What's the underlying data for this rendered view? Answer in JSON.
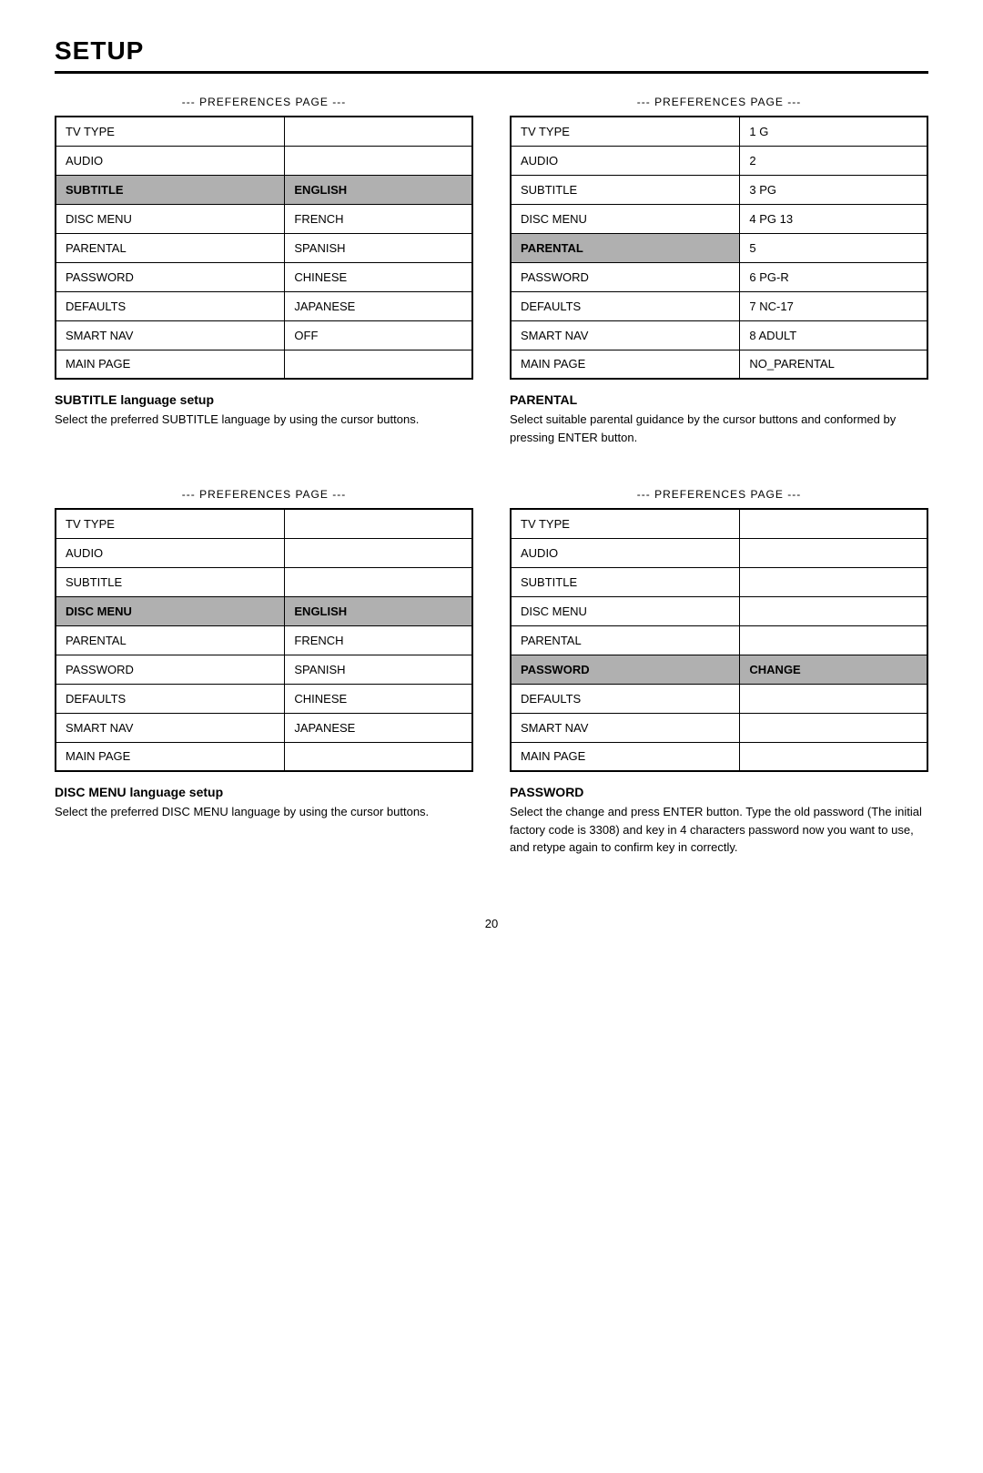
{
  "page": {
    "title": "SETUP",
    "page_number": "20"
  },
  "sections": [
    {
      "id": "top-left",
      "pref_label": "--- PREFERENCES PAGE ---",
      "rows": [
        {
          "left": "TV TYPE",
          "right": "",
          "left_highlight": false,
          "right_highlight": false
        },
        {
          "left": "AUDIO",
          "right": "",
          "left_highlight": false,
          "right_highlight": false
        },
        {
          "left": "SUBTITLE",
          "right": "ENGLISH",
          "left_highlight": true,
          "right_highlight": true
        },
        {
          "left": "DISC MENU",
          "right": "FRENCH",
          "left_highlight": false,
          "right_highlight": false
        },
        {
          "left": "PARENTAL",
          "right": "SPANISH",
          "left_highlight": false,
          "right_highlight": false
        },
        {
          "left": "PASSWORD",
          "right": "CHINESE",
          "left_highlight": false,
          "right_highlight": false
        },
        {
          "left": "DEFAULTS",
          "right": "JAPANESE",
          "left_highlight": false,
          "right_highlight": false
        },
        {
          "left": "SMART NAV",
          "right": "OFF",
          "left_highlight": false,
          "right_highlight": false
        },
        {
          "left": "MAIN PAGE",
          "right": "",
          "left_highlight": false,
          "right_highlight": false
        }
      ],
      "desc_title": "SUBTITLE language setup",
      "desc_text": "Select the preferred SUBTITLE language by using the cursor buttons."
    },
    {
      "id": "top-right",
      "pref_label": "--- PREFERENCES PAGE ---",
      "rows": [
        {
          "left": "TV TYPE",
          "right": "1 G",
          "left_highlight": false,
          "right_highlight": false
        },
        {
          "left": "AUDIO",
          "right": "2",
          "left_highlight": false,
          "right_highlight": false
        },
        {
          "left": "SUBTITLE",
          "right": "3 PG",
          "left_highlight": false,
          "right_highlight": false
        },
        {
          "left": "DISC MENU",
          "right": "4 PG 13",
          "left_highlight": false,
          "right_highlight": false
        },
        {
          "left": "PARENTAL",
          "right": "5",
          "left_highlight": true,
          "right_highlight": false
        },
        {
          "left": "PASSWORD",
          "right": "6 PG-R",
          "left_highlight": false,
          "right_highlight": false
        },
        {
          "left": "DEFAULTS",
          "right": "7 NC-17",
          "left_highlight": false,
          "right_highlight": false
        },
        {
          "left": "SMART NAV",
          "right": "8 ADULT",
          "left_highlight": false,
          "right_highlight": false
        },
        {
          "left": "MAIN PAGE",
          "right": "NO_PARENTAL",
          "left_highlight": false,
          "right_highlight": false
        }
      ],
      "desc_title": "PARENTAL",
      "desc_text": "Select suitable parental guidance by the cursor buttons and conformed by pressing ENTER button."
    },
    {
      "id": "bottom-left",
      "pref_label": "--- PREFERENCES PAGE ---",
      "rows": [
        {
          "left": "TV TYPE",
          "right": "",
          "left_highlight": false,
          "right_highlight": false
        },
        {
          "left": "AUDIO",
          "right": "",
          "left_highlight": false,
          "right_highlight": false
        },
        {
          "left": "SUBTITLE",
          "right": "",
          "left_highlight": false,
          "right_highlight": false
        },
        {
          "left": "DISC MENU",
          "right": "ENGLISH",
          "left_highlight": true,
          "right_highlight": true
        },
        {
          "left": "PARENTAL",
          "right": "FRENCH",
          "left_highlight": false,
          "right_highlight": false
        },
        {
          "left": "PASSWORD",
          "right": "SPANISH",
          "left_highlight": false,
          "right_highlight": false
        },
        {
          "left": "DEFAULTS",
          "right": "CHINESE",
          "left_highlight": false,
          "right_highlight": false
        },
        {
          "left": "SMART NAV",
          "right": "JAPANESE",
          "left_highlight": false,
          "right_highlight": false
        },
        {
          "left": "MAIN PAGE",
          "right": "",
          "left_highlight": false,
          "right_highlight": false
        }
      ],
      "desc_title": "DISC MENU language setup",
      "desc_text": "Select the preferred DISC MENU language by using the cursor buttons."
    },
    {
      "id": "bottom-right",
      "pref_label": "--- PREFERENCES PAGE ---",
      "rows": [
        {
          "left": "TV TYPE",
          "right": "",
          "left_highlight": false,
          "right_highlight": false
        },
        {
          "left": "AUDIO",
          "right": "",
          "left_highlight": false,
          "right_highlight": false
        },
        {
          "left": "SUBTITLE",
          "right": "",
          "left_highlight": false,
          "right_highlight": false
        },
        {
          "left": "DISC MENU",
          "right": "",
          "left_highlight": false,
          "right_highlight": false
        },
        {
          "left": "PARENTAL",
          "right": "",
          "left_highlight": false,
          "right_highlight": false
        },
        {
          "left": "PASSWORD",
          "right": "CHANGE",
          "left_highlight": true,
          "right_highlight": true
        },
        {
          "left": "DEFAULTS",
          "right": "",
          "left_highlight": false,
          "right_highlight": false
        },
        {
          "left": "SMART NAV",
          "right": "",
          "left_highlight": false,
          "right_highlight": false
        },
        {
          "left": "MAIN PAGE",
          "right": "",
          "left_highlight": false,
          "right_highlight": false
        }
      ],
      "desc_title": "PASSWORD",
      "desc_text": "Select the change and press ENTER button. Type the old password (The initial factory code is 3308) and key in 4 characters password now you want to use, and retype again to confirm key in correctly."
    }
  ]
}
